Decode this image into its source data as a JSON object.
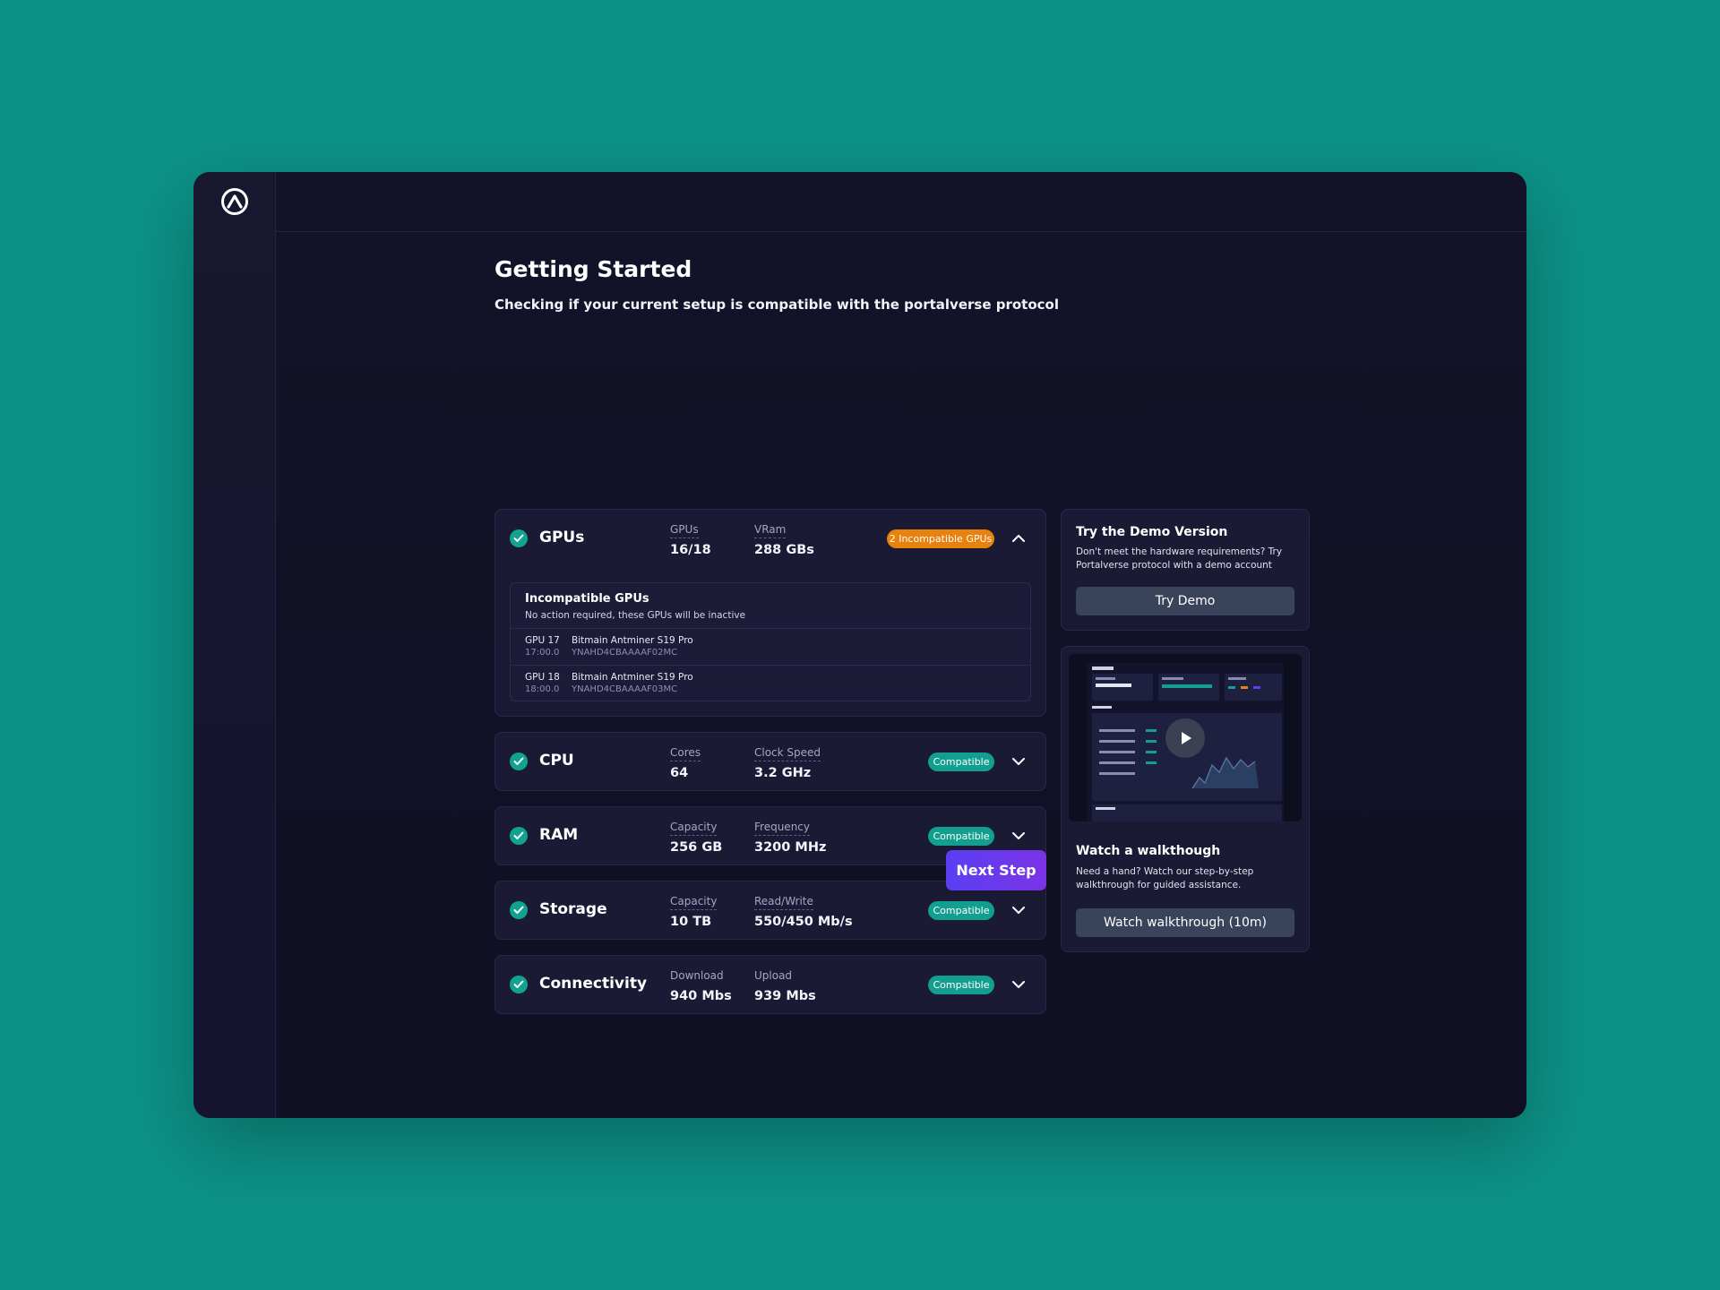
{
  "page": {
    "title": "Getting Started",
    "subtitle": "Checking if your current setup is compatible with the portalverse protocol"
  },
  "hardware": {
    "gpus": {
      "name": "GPUs",
      "m1_label": "GPUs",
      "m1_value": "16/18",
      "m2_label": "VRam",
      "m2_value": "288 GBs",
      "status": "2 Incompatible GPUs",
      "incompatible": {
        "title": "Incompatible GPUs",
        "desc": "No action required, these GPUs will be inactive",
        "rows": [
          {
            "id": "GPU 17",
            "time": "17:00.0",
            "model": "Bitmain Antminer S19 Pro",
            "serial": "YNAHD4CBAAAAF02MC"
          },
          {
            "id": "GPU 18",
            "time": "18:00.0",
            "model": "Bitmain Antminer S19 Pro",
            "serial": "YNAHD4CBAAAAF03MC"
          }
        ]
      }
    },
    "cpu": {
      "name": "CPU",
      "m1_label": "Cores",
      "m1_value": "64",
      "m2_label": "Clock Speed",
      "m2_value": "3.2 GHz",
      "status": "Compatible"
    },
    "ram": {
      "name": "RAM",
      "m1_label": "Capacity",
      "m1_value": "256 GB",
      "m2_label": "Frequency",
      "m2_value": "3200 MHz",
      "status": "Compatible"
    },
    "storage": {
      "name": "Storage",
      "m1_label": "Capacity",
      "m1_value": "10 TB",
      "m2_label": "Read/Write",
      "m2_value": "550/450 Mb/s",
      "status": "Compatible"
    },
    "connectivity": {
      "name": "Connectivity",
      "m1_label": "Download",
      "m1_value": "940 Mbs",
      "m2_label": "Upload",
      "m2_value": "939 Mbs",
      "status": "Compatible"
    }
  },
  "next_button": "Next Step",
  "demo": {
    "title": "Try the Demo Version",
    "desc": "Don't meet the hardware requirements? Try Portalverse protocol with a demo account",
    "button": "Try Demo"
  },
  "walkthrough": {
    "title": "Watch a walkthough",
    "desc": "Need a hand? Watch our step-by-step walkthrough for guided assistance.",
    "button": "Watch walkthrough (10m)"
  },
  "icons": {
    "logo": "portalverse-logo-icon",
    "check": "check-icon",
    "chevron_up": "chevron-up-icon",
    "chevron_down": "chevron-down-icon",
    "play": "play-icon"
  },
  "colors": {
    "background": "#0d9186",
    "panel": "#12122a",
    "card": "#1a1a35",
    "compatible": "#139f90",
    "warning": "#e8820e",
    "primary": "#5b3ff3"
  }
}
